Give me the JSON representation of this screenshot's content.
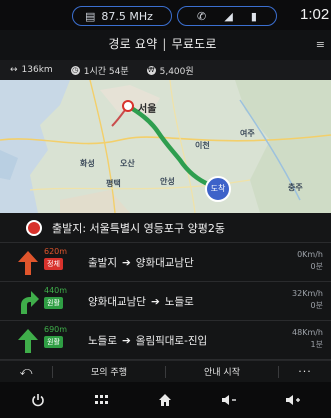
{
  "statusbar": {
    "radio": "87.5 MHz",
    "clock": "1:02"
  },
  "header": {
    "title_left": "경로 요약",
    "title_sep": "|",
    "title_right": "무료도로"
  },
  "summary": {
    "distance": "136km",
    "time": "1시간 54분",
    "toll": "5,400원"
  },
  "map": {
    "labels": [
      "서울",
      "화성",
      "오산",
      "평택",
      "이천",
      "여주",
      "안성",
      "충주"
    ],
    "destination_label": "도착",
    "route_color": "#2e9e4f",
    "dest_color": "#3d62c9"
  },
  "origin": {
    "text": "출발지: 서울특별시 영등포구 양평2동"
  },
  "steps": [
    {
      "distance": "620m",
      "tag": "정체",
      "tag_color": "#d8322c",
      "arrow_color": "#e0552c",
      "from": "출발지",
      "to": "양화대교남단",
      "km": "0Km/h",
      "min": "0분"
    },
    {
      "distance": "440m",
      "tag": "원활",
      "tag_color": "#2f9e44",
      "arrow_color": "#3fae4a",
      "from": "양화대교남단",
      "to": "노들로",
      "km": "32Km/h",
      "min": "0분"
    },
    {
      "distance": "690m",
      "tag": "원활",
      "tag_color": "#2f9e44",
      "arrow_color": "#3fae4a",
      "from": "노들로",
      "to": "올림픽대로-진입",
      "km": "48Km/h",
      "min": "1분"
    }
  ],
  "actions": {
    "simulate": "모의 주행",
    "start": "안내 시작",
    "more": "···"
  },
  "icons": {
    "back": "back-arrow-icon",
    "power": "power-icon",
    "apps": "apps-grid-icon",
    "home": "home-icon",
    "vol_down": "volume-down-icon",
    "vol_up": "volume-up-icon"
  }
}
